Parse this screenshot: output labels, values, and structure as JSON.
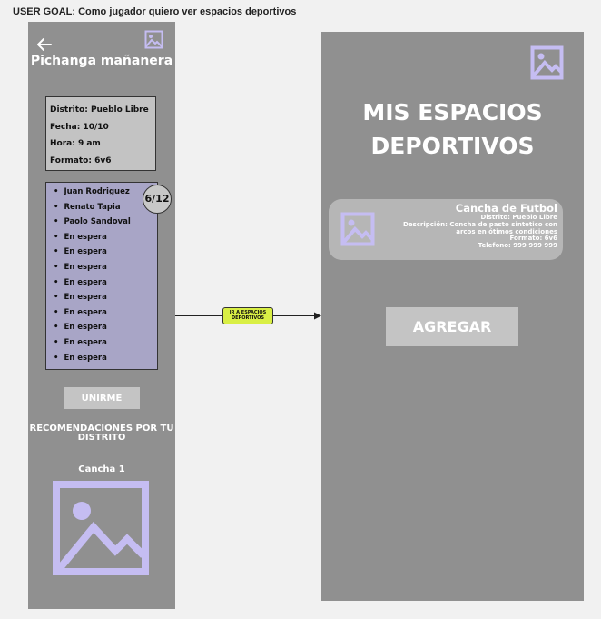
{
  "user_goal": "USER GOAL: Como jugador quiero ver espacios deportivos",
  "left_screen": {
    "back_icon": "arrow-left-icon",
    "title": "Pichanga mañanera",
    "match_info": {
      "district": "Distrito: Pueblo Libre",
      "date": "Fecha: 10/10",
      "time": "Hora: 9 am",
      "format": "Formato: 6v6"
    },
    "players": [
      "Juan Rodriguez",
      "Renato Tapia",
      "Paolo Sandoval",
      "En espera",
      "En espera",
      "En espera",
      "En espera",
      "En espera",
      "En espera",
      "En espera",
      "En espera",
      "En espera"
    ],
    "player_count": "6/12",
    "join_label": "UNIRME",
    "recommendations_title": "RECOMENDACIONES POR TU DISTRITO",
    "recommended_item": "Cancha 1"
  },
  "connector": {
    "label": "IR A ESPACIOS DEPORTIVOS"
  },
  "right_screen": {
    "title": "MIS ESPACIOS DEPORTIVOS",
    "card": {
      "name": "Cancha de Futbol",
      "district": "Distrito: Pueblo Libre",
      "description": "Descripción: Concha de pasto sintetico con arcos en ótimos condiciones",
      "format": "Formato: 6v6",
      "phone": "Telefono: 999 999 999"
    },
    "add_label": "AGREGAR"
  },
  "colors": {
    "screen_bg": "#909090",
    "icon_lavender": "#c5bdf2",
    "player_list_bg": "#a8a5c6",
    "connector_label_bg": "#d9ef45"
  }
}
